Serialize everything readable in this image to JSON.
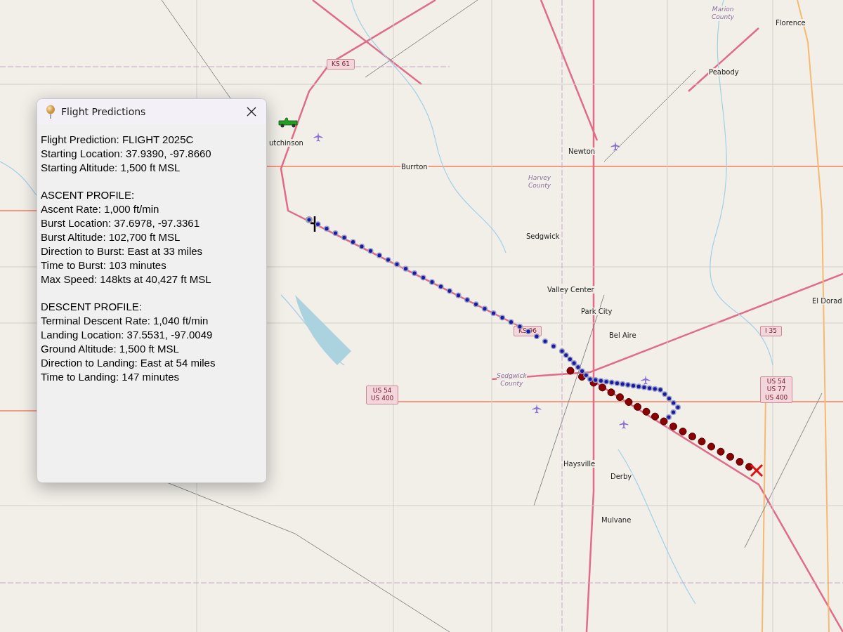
{
  "map": {
    "places": [
      "Florence",
      "Peabody",
      "utchinson",
      "Newton",
      "Burrton",
      "Sedgwick",
      "Valley Center",
      "Park City",
      "Bel Aire",
      "El Dorad",
      "Haysville",
      "Derby",
      "Mulvane"
    ],
    "counties": [
      [
        "Marion",
        "County"
      ],
      [
        "Harvey",
        "County"
      ],
      [
        "Sedgwick",
        "County"
      ]
    ],
    "shields": [
      [
        "KS 61"
      ],
      [
        "KS 96"
      ],
      [
        "I 35"
      ],
      [
        "US 54",
        "US 400"
      ],
      [
        "US 54",
        "US 77",
        "US 400"
      ]
    ]
  },
  "dialog": {
    "title": "Flight Predictions",
    "sections": [
      [
        "Flight Prediction: FLIGHT 2025C",
        "Starting Location: 37.9390, -97.8660",
        "Starting Altitude: 1,500 ft MSL"
      ],
      [
        "ASCENT PROFILE:",
        "Ascent Rate: 1,000 ft/min",
        "Burst Location: 37.6978, -97.3361",
        "Burst Altitude: 102,700 ft MSL",
        "Direction to Burst: East at 33 miles",
        "Time to Burst: 103 minutes",
        "Max Speed: 148kts at 40,427 ft MSL"
      ],
      [
        "DESCENT PROFILE:",
        "Terminal Descent Rate: 1,040 ft/min",
        "Landing Location: 37.5531, -97.0049",
        "Ground Altitude: 1,500 ft MSL",
        "Direction to Landing: East at 54 miles",
        "Time to Landing: 147 minutes"
      ]
    ]
  }
}
